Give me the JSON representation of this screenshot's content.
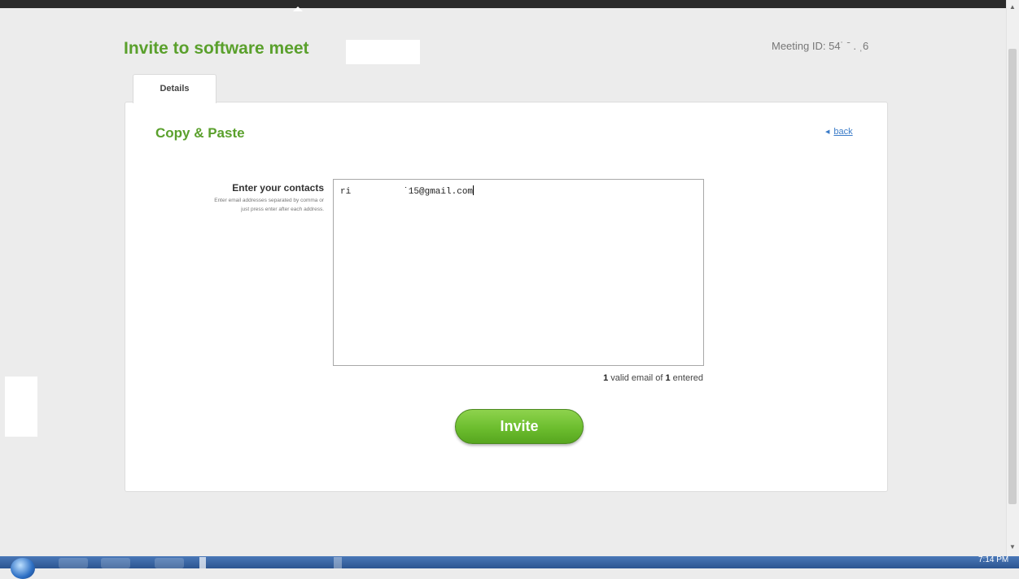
{
  "page": {
    "title": "Invite to  software meet",
    "meeting_id": "Meeting ID: 54˙ ˉ . ˌ6"
  },
  "tabs": [
    {
      "label": "Details"
    }
  ],
  "section": {
    "title": "Copy & Paste",
    "back_label": "back"
  },
  "contacts": {
    "label": "Enter your contacts",
    "help_line1": "Enter email addresses separated by comma or",
    "help_line2": "just press enter after each address.",
    "value_start": "ri",
    "value_end": "˙15@gmail.com"
  },
  "validation": {
    "count_valid": "1",
    "text_mid": " valid email of ",
    "count_entered": "1",
    "text_end": " entered"
  },
  "actions": {
    "invite_label": "Invite"
  },
  "taskbar": {
    "clock": "7:14 PM"
  },
  "colors": {
    "accent_green": "#5aa02c",
    "link_blue": "#3a7bc8",
    "button_green": "#6cbd2e"
  },
  "icons": [
    "scroll-up-arrow-icon",
    "scroll-down-arrow-icon",
    "back-arrow-icon",
    "start-orb-icon"
  ]
}
